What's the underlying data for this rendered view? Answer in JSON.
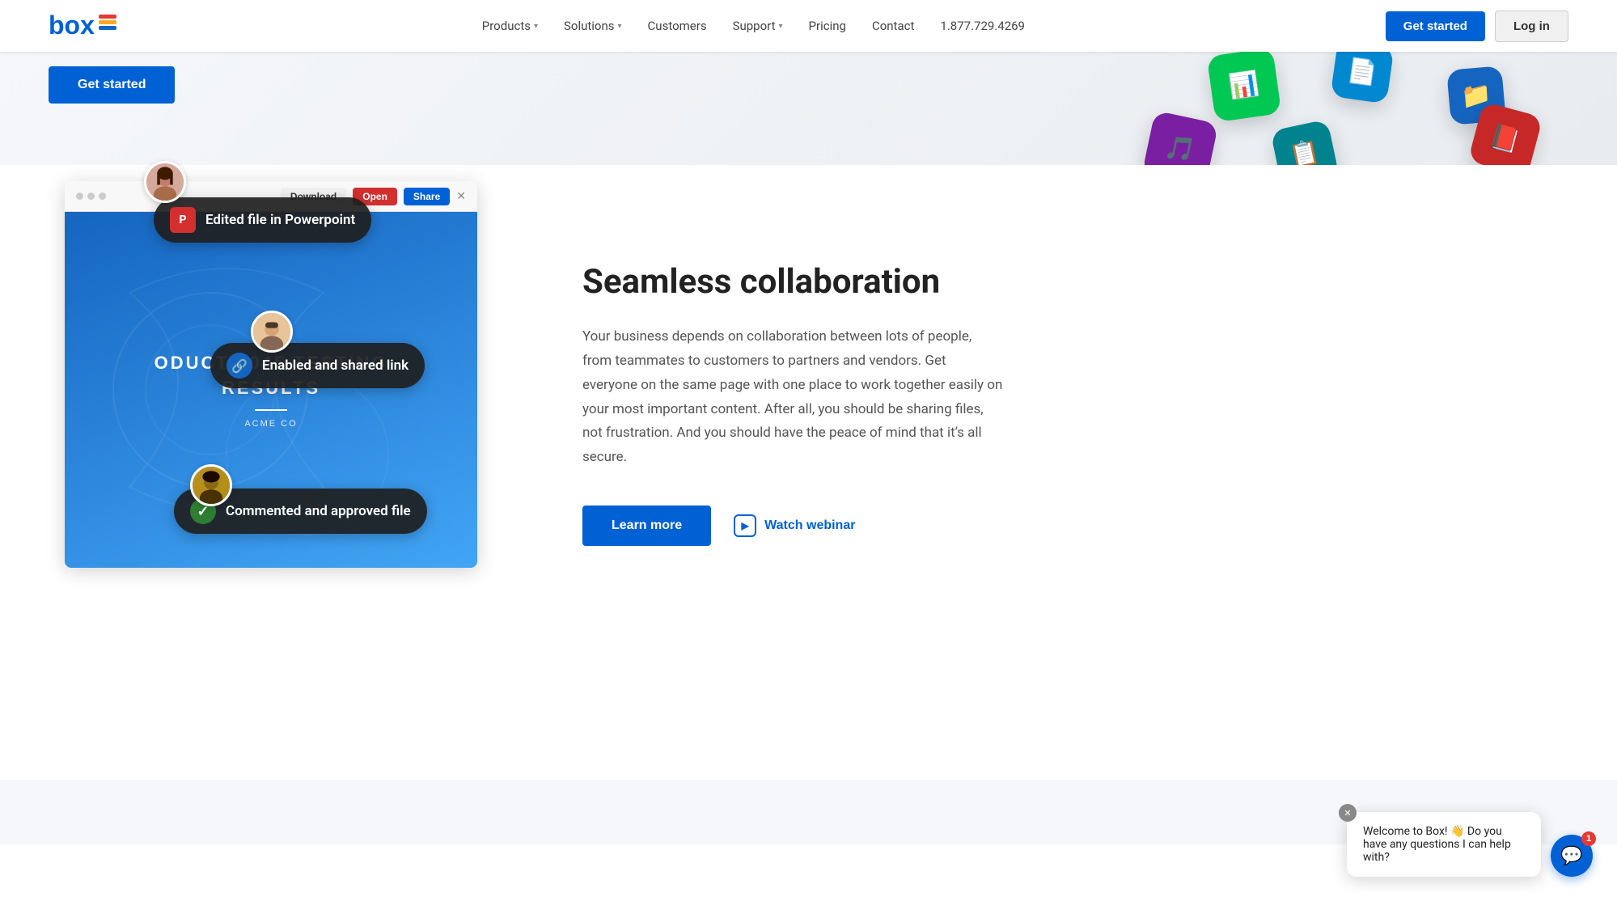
{
  "nav": {
    "logo_alt": "Box",
    "links": [
      {
        "label": "Products",
        "has_dropdown": true
      },
      {
        "label": "Solutions",
        "has_dropdown": true
      },
      {
        "label": "Customers",
        "has_dropdown": false
      },
      {
        "label": "Support",
        "has_dropdown": true
      },
      {
        "label": "Pricing",
        "has_dropdown": false
      },
      {
        "label": "Contact",
        "has_dropdown": false
      }
    ],
    "phone": "1.877.729.4269",
    "get_started": "Get started",
    "login": "Log in"
  },
  "hero": {
    "cta_button": "Get started"
  },
  "collaboration": {
    "title": "Seamless collaboration",
    "description": "Your business depends on collaboration between lots of people, from teammates to customers to partners and vendors. Get everyone on the same page with one place to work together easily on your most important content. After all, you should be sharing files, not frustration. And you should have the peace of mind that it’s all secure.",
    "learn_more": "Learn more",
    "watch_webinar": "Watch webinar"
  },
  "presentation": {
    "toolbar": {
      "download": "Download",
      "open": "Open",
      "share": "Share"
    },
    "slide_title": "ODUCT 3045 TESTING\nRESULTS",
    "slide_sub": "ACME CO"
  },
  "badges": {
    "powerpoint": "Edited file in Powerpoint",
    "link": "Enabled and shared link",
    "approved": "Commented and approved file"
  },
  "chat": {
    "message": "Welcome to Box! 👋 Do you have any questions I can help with?",
    "badge_count": "1"
  }
}
